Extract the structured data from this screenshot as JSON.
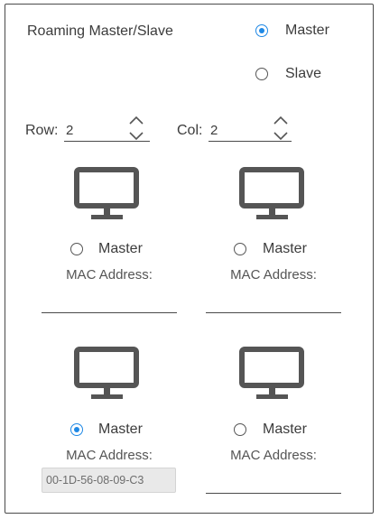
{
  "roaming": {
    "label": "Roaming Master/Slave",
    "options": [
      {
        "label": "Master",
        "checked": true
      },
      {
        "label": "Slave",
        "checked": false
      }
    ]
  },
  "grid": {
    "row_label": "Row:",
    "row_value": "2",
    "col_label": "Col:",
    "col_value": "2"
  },
  "displays": [
    {
      "master_label": "Master",
      "checked": false,
      "mac_label": "MAC Address:",
      "mac_value": ""
    },
    {
      "master_label": "Master",
      "checked": false,
      "mac_label": "MAC Address:",
      "mac_value": ""
    },
    {
      "master_label": "Master",
      "checked": true,
      "mac_label": "MAC Address:",
      "mac_value": "00-1D-56-08-09-C3"
    },
    {
      "master_label": "Master",
      "checked": false,
      "mac_label": "MAC Address:",
      "mac_value": ""
    }
  ],
  "colors": {
    "accent": "#1e88e5",
    "border": "#4a4a4a",
    "text": "#3c3c3c",
    "mac_fill": "#e9e9e9"
  },
  "icons": {
    "display": "monitor-icon",
    "spinner": "up-down-chevron-icon"
  }
}
